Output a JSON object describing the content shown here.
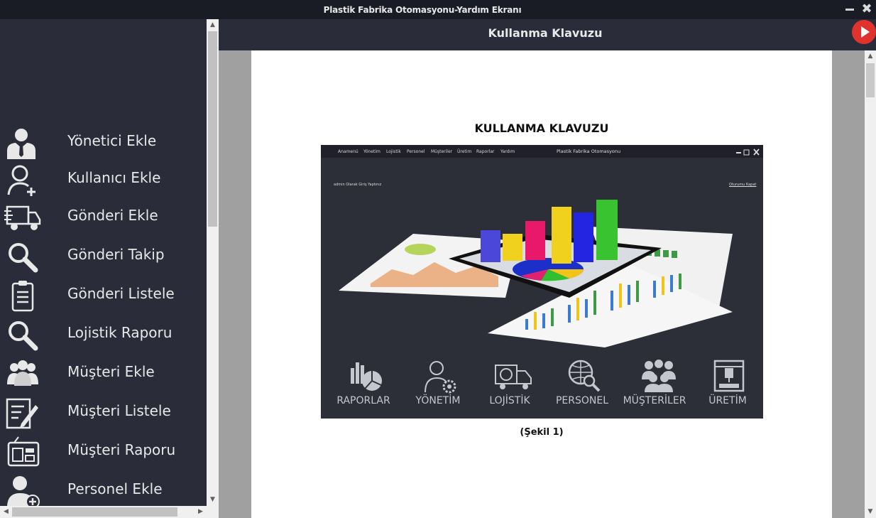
{
  "window": {
    "title": "Plastik Fabrika Otomasyonu-Yardım Ekranı",
    "minimize_icon": "minimize-icon",
    "close_icon": "close-icon",
    "close_glyph": "✖"
  },
  "sidebar": {
    "items": [
      {
        "label": "Yönetici Ekle",
        "icon": "admin-user-icon"
      },
      {
        "label": "Kullanıcı Ekle",
        "icon": "add-user-icon"
      },
      {
        "label": "Gönderi Ekle",
        "icon": "delivery-truck-icon"
      },
      {
        "label": "Gönderi Takip",
        "icon": "search-icon"
      },
      {
        "label": "Gönderi Listele",
        "icon": "clipboard-list-icon"
      },
      {
        "label": "Lojistik Raporu",
        "icon": "search-icon"
      },
      {
        "label": "Müşteri Ekle",
        "icon": "group-icon"
      },
      {
        "label": "Müşteri Listele",
        "icon": "edit-list-icon"
      },
      {
        "label": "Müşteri Raporu",
        "icon": "report-device-icon"
      },
      {
        "label": "Personel Ekle",
        "icon": "add-person-icon"
      }
    ]
  },
  "header": {
    "title": "Kullanma Klavuzu",
    "play_icon": "play-icon"
  },
  "document": {
    "heading": "KULLANMA KLAVUZU",
    "caption": "(Şekil 1)",
    "figure": {
      "menu": [
        "Anamenü",
        "Yönetim",
        "Lojistik",
        "Personel",
        "Müşteriler",
        "Üretim",
        "Raporlar",
        "Yardım"
      ],
      "title": "Plastik Fabrika Otomasyonu",
      "login_note": "admin Olarak Giriş Yaptınız",
      "logout": "Oturumu Kapat",
      "modules": [
        "RAPORLAR",
        "YÖNETİM",
        "LOJİSTİK",
        "PERSONEL",
        "MÜŞTERİLER",
        "ÜRETİM"
      ]
    }
  },
  "scroll": {
    "up_glyph": "▲",
    "down_glyph": "▼",
    "left_glyph": "◀",
    "right_glyph": "▶"
  },
  "colors": {
    "sidebar_bg": "#2a2d39",
    "titlebar_bg": "#1a1c25",
    "accent_play": "#e0332d",
    "doc_gutter": "#a0a0a0"
  }
}
